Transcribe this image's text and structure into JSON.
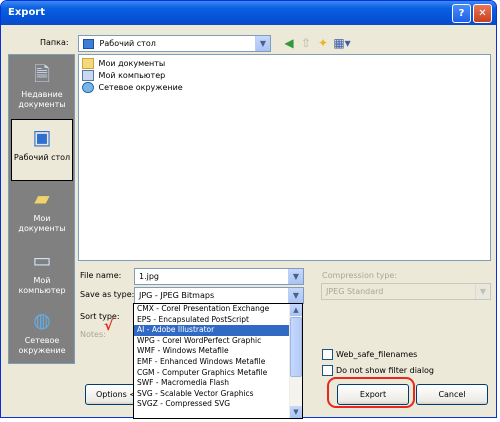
{
  "window": {
    "title": "Export",
    "help_glyph": "?",
    "close_glyph": "✕"
  },
  "folder_bar": {
    "label": "Папка:",
    "current": "Рабочий стол"
  },
  "places": [
    {
      "label": "Недавние документы",
      "icon": "recent-documents-icon"
    },
    {
      "label": "Рабочий стол",
      "icon": "desktop-icon",
      "active": true
    },
    {
      "label": "Мои документы",
      "icon": "my-documents-icon"
    },
    {
      "label": "Мой компьютер",
      "icon": "my-computer-icon"
    },
    {
      "label": "Сетевое окружение",
      "icon": "network-icon"
    }
  ],
  "files": [
    {
      "name": "Мои документы",
      "icon": "folder-icon"
    },
    {
      "name": "Мой компьютер",
      "icon": "computer-icon"
    },
    {
      "name": "Сетевое окружение",
      "icon": "network-icon"
    }
  ],
  "form": {
    "file_name_label": "File name:",
    "file_name_value": "1.jpg",
    "save_as_label": "Save as type:",
    "save_as_value": "JPG - JPEG Bitmaps",
    "sort_type_label": "Sort type:",
    "notes_label": "Notes:",
    "compression_label": "Compression type:",
    "compression_value": "JPEG Standard"
  },
  "options": {
    "web_safe_label": "Web_safe_filenames",
    "no_filter_label": "Do not show filter dialog"
  },
  "buttons": {
    "options": "Options <",
    "export": "Export",
    "cancel": "Cancel"
  },
  "type_list": {
    "items": [
      "CMX - Corel Presentation Exchange",
      "EPS - Encapsulated PostScript",
      "AI - Adobe Illustrator",
      "WPG - Corel WordPerfect Graphic",
      "WMF - Windows Metafile",
      "EMF - Enhanced Windows Metafile",
      "CGM - Computer Graphics Metafile",
      "SWF - Macromedia Flash",
      "SVG - Scalable Vector Graphics",
      "SVGZ - Compressed SVG"
    ],
    "selected": "AI - Adobe Illustrator"
  },
  "annotation_mark": "√"
}
